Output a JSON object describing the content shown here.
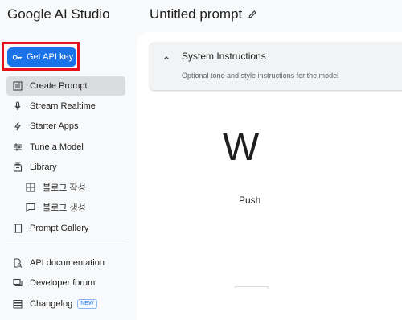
{
  "header": {
    "app_name": "Google AI Studio",
    "prompt_title": "Untitled prompt",
    "edit_icon": "pencil-icon"
  },
  "sidebar": {
    "api_button": {
      "label": "Get API key",
      "icon": "key-icon"
    },
    "items": [
      {
        "label": "Create Prompt",
        "icon": "create-prompt-icon",
        "active": true
      },
      {
        "label": "Stream Realtime",
        "icon": "microphone-icon"
      },
      {
        "label": "Starter Apps",
        "icon": "lightning-icon"
      },
      {
        "label": "Tune a Model",
        "icon": "sliders-icon"
      },
      {
        "label": "Library",
        "icon": "library-icon"
      },
      {
        "label": "블로그 작성",
        "icon": "table-icon"
      },
      {
        "label": "블로그 생성",
        "icon": "chat-icon"
      },
      {
        "label": "Prompt Gallery",
        "icon": "gallery-icon"
      },
      {
        "label": "API documentation",
        "icon": "document-search-icon"
      },
      {
        "label": "Developer forum",
        "icon": "forum-icon"
      },
      {
        "label": "Changelog",
        "icon": "changelog-icon",
        "badge": "NEW"
      }
    ]
  },
  "main": {
    "system_instructions": {
      "title": "System Instructions",
      "placeholder": "Optional tone and style instructions for the model"
    },
    "welcome_text": "W",
    "push_text": "Push"
  },
  "colors": {
    "accent": "#1a73e8",
    "highlight_border": "#e8111a",
    "active_bg": "#dadce0"
  }
}
